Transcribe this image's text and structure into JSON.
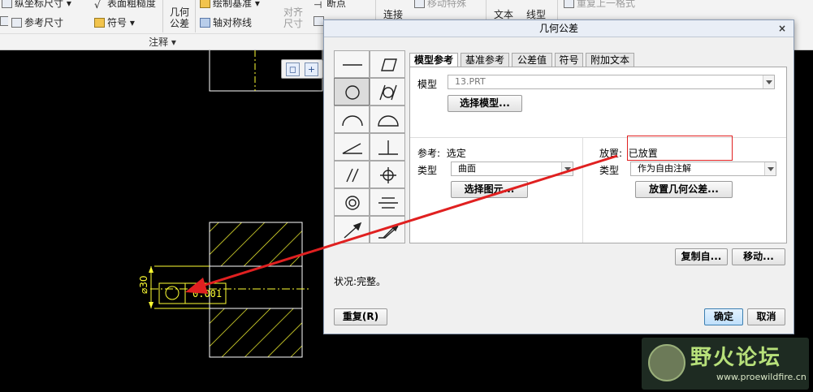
{
  "ribbon": {
    "row1": [
      {
        "icon": "ordinate-dim-icon",
        "label": "纵坐标尺寸",
        "has_dropdown": true
      },
      {
        "icon": "surface-finish-icon",
        "label": "表面粗糙度"
      },
      {
        "icon": "sketch-datum-icon",
        "label": "绘制基准",
        "has_dropdown": true
      },
      {
        "icon": "break-icon",
        "label": "断点"
      },
      {
        "icon": "connect-icon",
        "label": "连接"
      },
      {
        "icon": "move-special-icon",
        "label": "移动特殊",
        "disabled": true
      },
      {
        "icon": "text-icon",
        "label": "文本"
      },
      {
        "icon": "linetype-icon",
        "label": "线型"
      },
      {
        "icon": "repeat-format-icon",
        "label": "重复上一格式",
        "disabled": true
      }
    ],
    "row2": [
      {
        "icon": "ref-dim-icon",
        "label": "参考尺寸"
      },
      {
        "icon": "symbol-icon",
        "label": "符号",
        "has_dropdown": true
      },
      {
        "icon": "axis-symmetry-icon",
        "label": "轴对称线"
      }
    ],
    "big_buttons": [
      {
        "icon": "geometric-tolerance-icon",
        "label": "几何\n公差"
      },
      {
        "icon": "align-dims-icon",
        "label": "对齐\n尺寸",
        "disabled": true
      }
    ],
    "group_label": "注释 ▾"
  },
  "drawing": {
    "dimension_text": "⌀30",
    "gtol_text": "0.001",
    "colors": {
      "geometry": "#ffff33",
      "hatch": "#ffff33",
      "centerline": "#ffff33"
    }
  },
  "dialog": {
    "title": "几何公差",
    "close_label": "×",
    "symbols": [
      {
        "name": "straightness-icon",
        "selected": false
      },
      {
        "name": "flatness-icon",
        "selected": false
      },
      {
        "name": "circularity-icon",
        "selected": true
      },
      {
        "name": "cylindricity-icon",
        "selected": false
      },
      {
        "name": "profile-of-line-icon",
        "selected": false
      },
      {
        "name": "profile-of-surface-icon",
        "selected": false
      },
      {
        "name": "angularity-icon",
        "selected": false
      },
      {
        "name": "perpendicularity-icon",
        "selected": false
      },
      {
        "name": "parallelism-icon",
        "selected": false
      },
      {
        "name": "position-icon",
        "selected": false
      },
      {
        "name": "concentricity-icon",
        "selected": false
      },
      {
        "name": "symmetry-icon",
        "selected": false
      },
      {
        "name": "circular-runout-icon",
        "selected": false
      },
      {
        "name": "total-runout-icon",
        "selected": false
      }
    ],
    "tabs": [
      {
        "label": "模型参考",
        "active": true
      },
      {
        "label": "基准参考",
        "active": false
      },
      {
        "label": "公差值",
        "active": false
      },
      {
        "label": "符号",
        "active": false
      },
      {
        "label": "附加文本",
        "active": false
      }
    ],
    "model_label": "模型",
    "model_value": "13.PRT",
    "select_model_button": "选择模型...",
    "reference": {
      "label": "参考",
      "status": "选定",
      "type_label": "类型",
      "type_value": "曲面",
      "select_entity_button": "选择图元..."
    },
    "placement": {
      "label": "放置",
      "status": "已放置",
      "type_label": "类型",
      "type_value": "作为自由注解",
      "place_button": "放置几何公差..."
    },
    "copy_from_button": "复制自...",
    "move_button": "移动...",
    "status_text": "状况:完整。",
    "repeat_button": "重复(R)",
    "ok_button": "确定",
    "cancel_button": "取消"
  },
  "watermark": {
    "title": "野火论坛",
    "url": "www.proewildfire.cn"
  },
  "colors": {
    "annotation": "#e02020",
    "dialog_bg": "#f0f0f0",
    "ok_button": "#cfe6fb"
  }
}
